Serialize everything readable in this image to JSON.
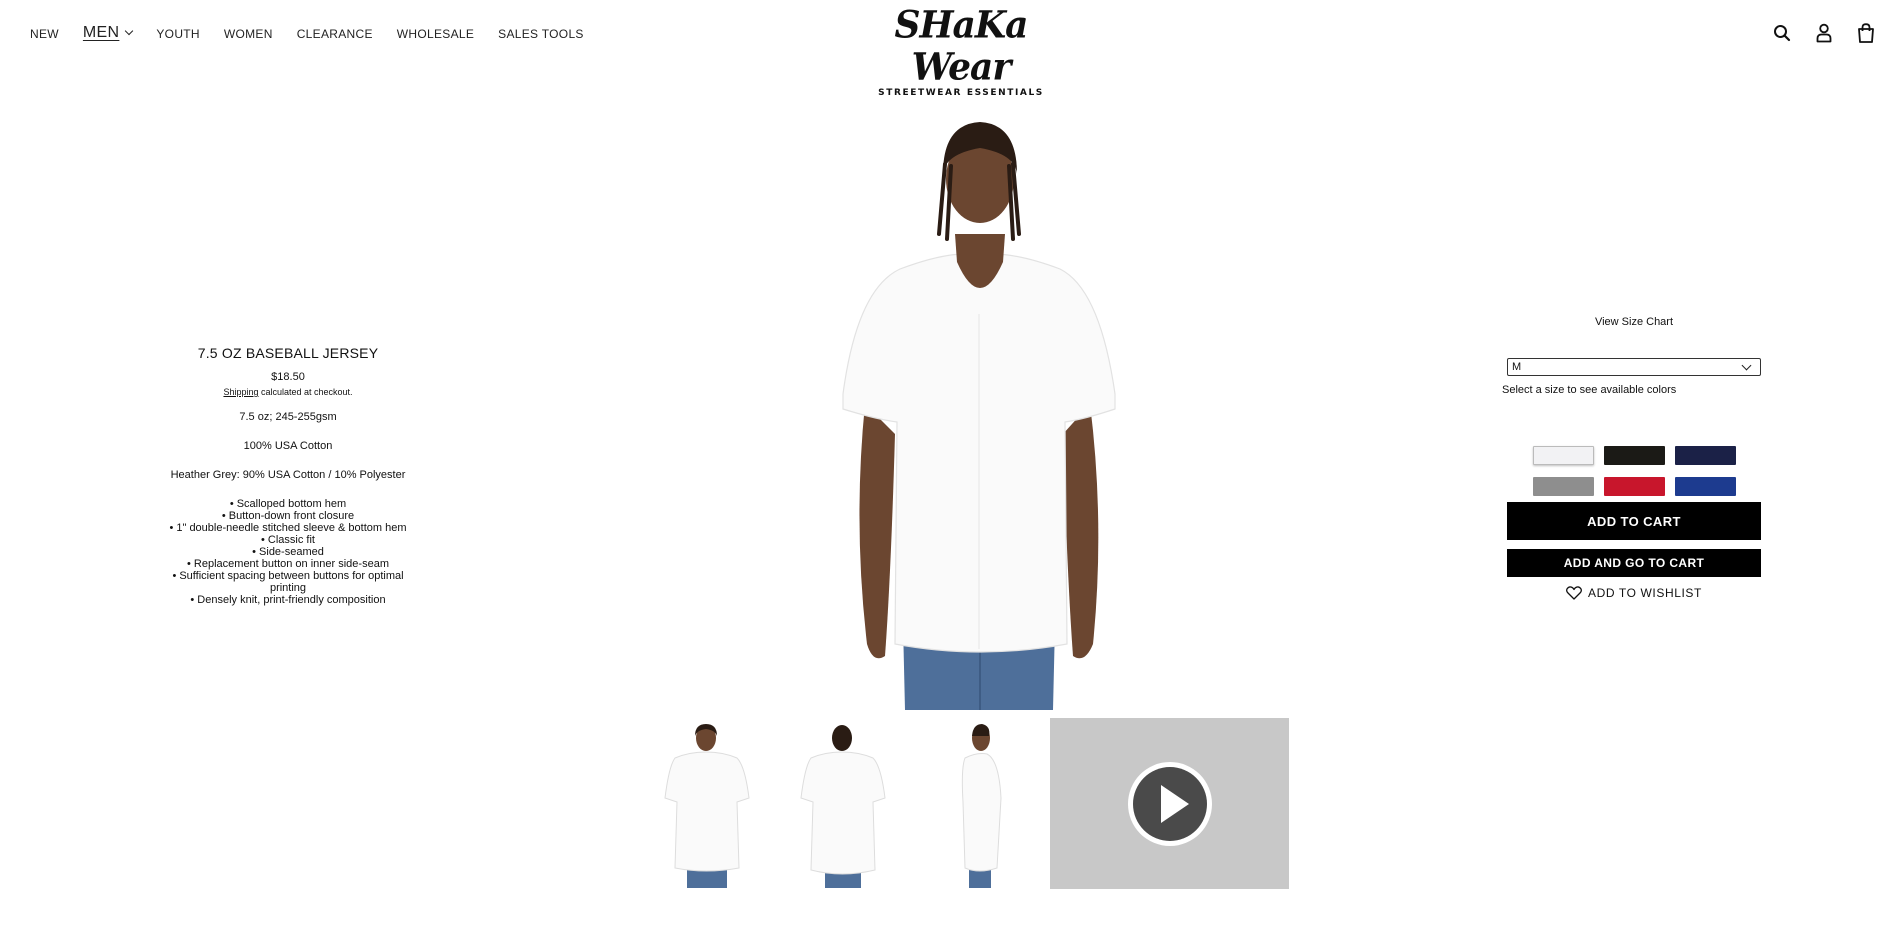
{
  "nav": {
    "items": [
      {
        "label": "NEW"
      },
      {
        "label": "MEN"
      },
      {
        "label": "YOUTH"
      },
      {
        "label": "WOMEN"
      },
      {
        "label": "CLEARANCE"
      },
      {
        "label": "WHOLESALE"
      },
      {
        "label": "SALES TOOLS"
      }
    ]
  },
  "logo": {
    "word": "SHaKa Wear",
    "tagline": "STREETWEAR ESSENTIALS"
  },
  "header_icons": [
    "search-icon",
    "account-icon",
    "cart-icon"
  ],
  "product": {
    "title": "7.5 OZ BASEBALL JERSEY",
    "price": "$18.50",
    "shipping_link": "Shipping",
    "shipping_rest": " calculated at checkout.",
    "weight": "7.5 oz; 245-255gsm",
    "material": "100% USA Cotton",
    "heather": "Heather Grey: 90% USA Cotton / 10% Polyester",
    "bullets": [
      "• Scalloped bottom hem",
      "• Button-down front closure",
      "• 1\" double-needle stitched sleeve & bottom hem",
      "• Classic fit",
      "• Side-seamed",
      "• Replacement button on inner side-seam",
      "• Sufficient spacing between buttons for optimal printing",
      "• Densely knit, print-friendly composition"
    ]
  },
  "purchase": {
    "size_chart": "View Size Chart",
    "size_selected": "M",
    "helper": "Select a size to see available colors",
    "swatches": [
      "#f2f2f4",
      "#1b1a16",
      "#1b2147",
      "#8e8e8e",
      "#c8162c",
      "#1d3b8f"
    ],
    "add_to_cart": "ADD TO CART",
    "add_and_go": "ADD AND GO TO CART",
    "wishlist": "ADD TO WISHLIST"
  }
}
